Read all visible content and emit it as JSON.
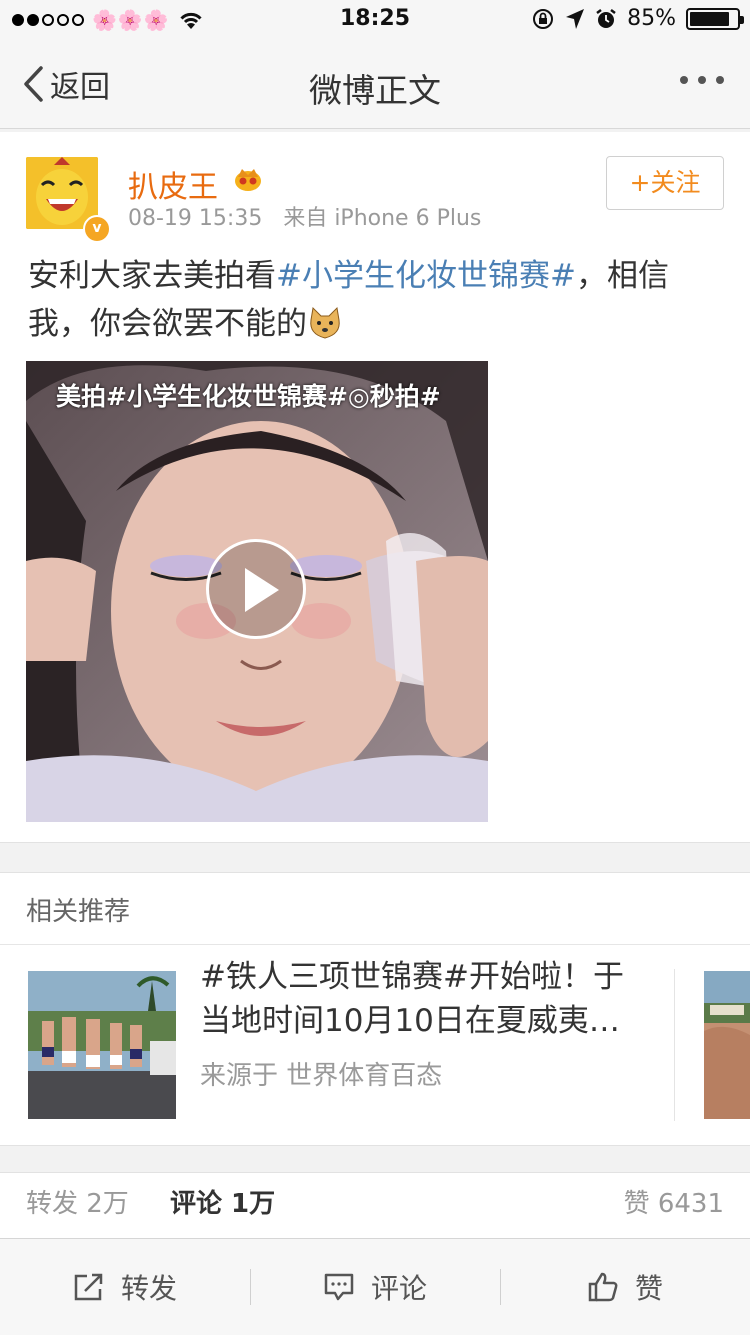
{
  "status_bar": {
    "time": "18:25",
    "battery_text": "85%",
    "battery_level": 0.85,
    "signal_dots_filled": 2,
    "signal_dots_total": 5,
    "emoji": "🌸🌸🌸"
  },
  "nav": {
    "back_label": "返回",
    "title": "微博正文"
  },
  "post": {
    "username": "扒皮王",
    "time": "08-19 15:35",
    "source": "来自 iPhone 6 Plus",
    "follow_label": "+关注",
    "text_before": "安利大家去美拍看",
    "topic": "#小学生化妆世锦赛#",
    "text_after": "，相信我，你会欲罢不能的",
    "video_caption": "美拍#小学生化妆世锦赛#◎秒拍#"
  },
  "related": {
    "heading": "相关推荐",
    "item_title_line1": "#铁人三项世锦赛#开始啦！于",
    "item_title_line2": "当地时间10月10日在夏威夷…",
    "item_source": "来源于 世界体育百态"
  },
  "stats": {
    "repost": "转发 2万",
    "comment": "评论 1万",
    "like": "赞 6431"
  },
  "toolbar": {
    "repost_label": "转发",
    "comment_label": "评论",
    "like_label": "赞"
  }
}
